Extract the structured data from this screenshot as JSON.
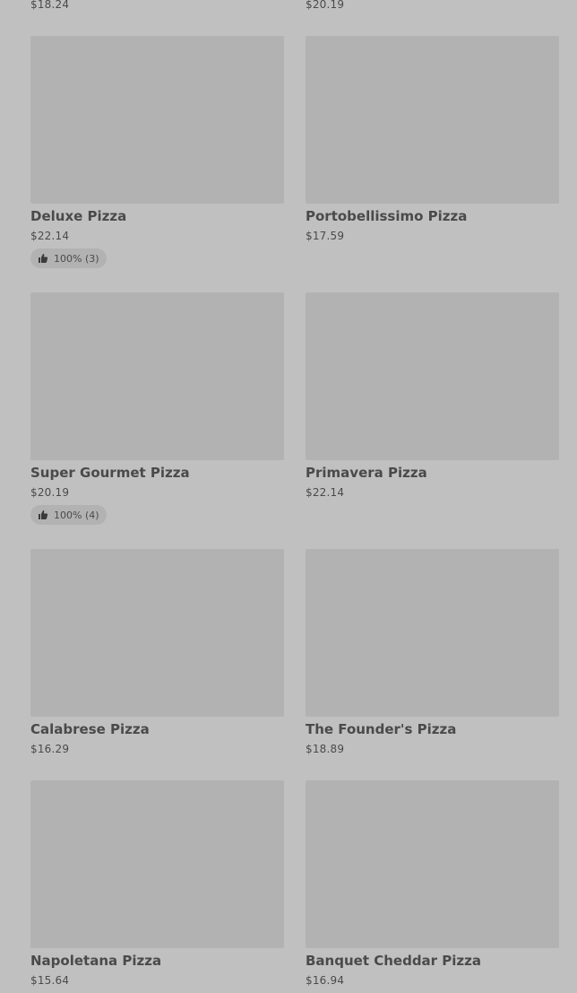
{
  "top_row": {
    "left_price": "$18.24",
    "right_price": "$20.19"
  },
  "items": [
    {
      "name": "Deluxe Pizza",
      "price": "$22.14",
      "rating": "100% (3)"
    },
    {
      "name": "Portobellissimo Pizza",
      "price": "$17.59"
    },
    {
      "name": "Super Gourmet Pizza",
      "price": "$20.19",
      "rating": "100% (4)"
    },
    {
      "name": "Primavera Pizza",
      "price": "$22.14"
    },
    {
      "name": "Calabrese Pizza",
      "price": "$16.29"
    },
    {
      "name": "The Founder's Pizza",
      "price": "$18.89"
    },
    {
      "name": "Napoletana Pizza",
      "price": "$15.64"
    },
    {
      "name": "Banquet Cheddar Pizza",
      "price": "$16.94"
    }
  ],
  "icons": {
    "rating": "thumbs-up-icon"
  }
}
